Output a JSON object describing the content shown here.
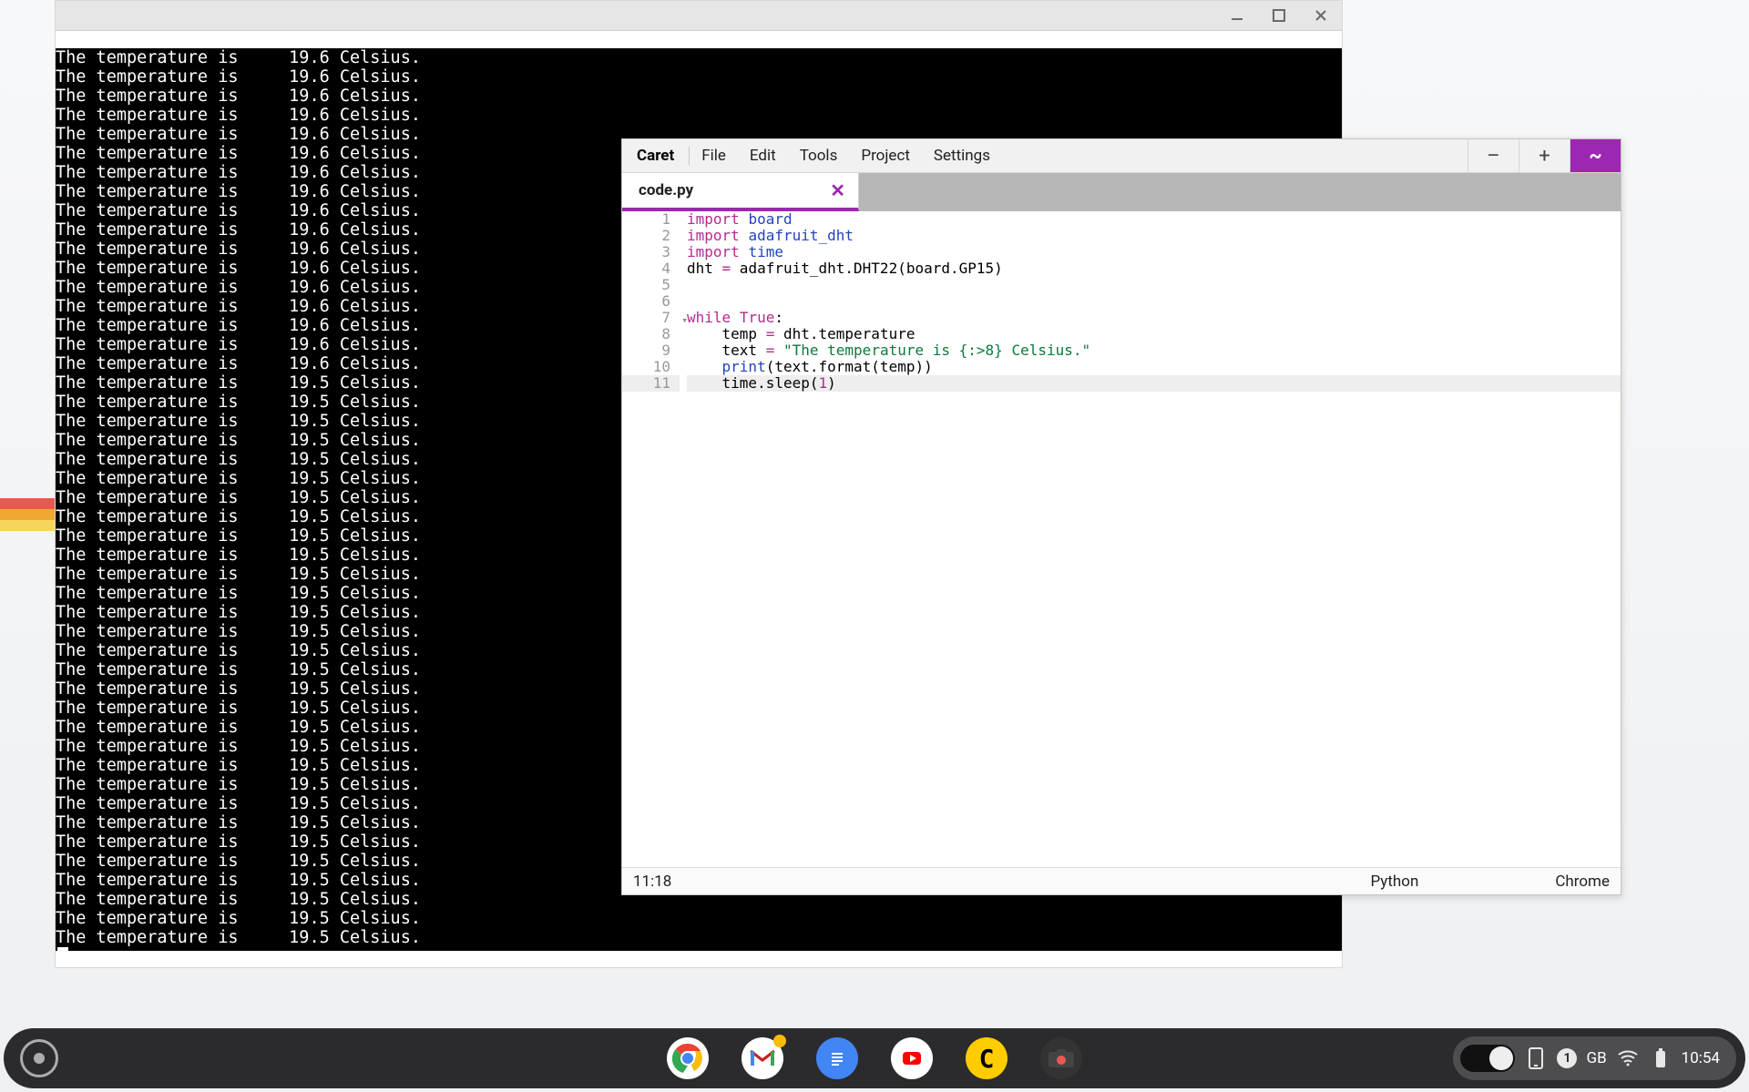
{
  "edge_tabs": [
    "#e85a4f",
    "#f0a830",
    "#f6d55c"
  ],
  "terminal": {
    "lines": [
      "The temperature is     19.6 Celsius.",
      "The temperature is     19.6 Celsius.",
      "The temperature is     19.6 Celsius.",
      "The temperature is     19.6 Celsius.",
      "The temperature is     19.6 Celsius.",
      "The temperature is     19.6 Celsius.",
      "The temperature is     19.6 Celsius.",
      "The temperature is     19.6 Celsius.",
      "The temperature is     19.6 Celsius.",
      "The temperature is     19.6 Celsius.",
      "The temperature is     19.6 Celsius.",
      "The temperature is     19.6 Celsius.",
      "The temperature is     19.6 Celsius.",
      "The temperature is     19.6 Celsius.",
      "The temperature is     19.6 Celsius.",
      "The temperature is     19.6 Celsius.",
      "The temperature is     19.6 Celsius.",
      "The temperature is     19.5 Celsius.",
      "The temperature is     19.5 Celsius.",
      "The temperature is     19.5 Celsius.",
      "The temperature is     19.5 Celsius.",
      "The temperature is     19.5 Celsius.",
      "The temperature is     19.5 Celsius.",
      "The temperature is     19.5 Celsius.",
      "The temperature is     19.5 Celsius.",
      "The temperature is     19.5 Celsius.",
      "The temperature is     19.5 Celsius.",
      "The temperature is     19.5 Celsius.",
      "The temperature is     19.5 Celsius.",
      "The temperature is     19.5 Celsius.",
      "The temperature is     19.5 Celsius.",
      "The temperature is     19.5 Celsius.",
      "The temperature is     19.5 Celsius.",
      "The temperature is     19.5 Celsius.",
      "The temperature is     19.5 Celsius.",
      "The temperature is     19.5 Celsius.",
      "The temperature is     19.5 Celsius.",
      "The temperature is     19.5 Celsius.",
      "The temperature is     19.5 Celsius.",
      "The temperature is     19.5 Celsius.",
      "The temperature is     19.5 Celsius.",
      "The temperature is     19.5 Celsius.",
      "The temperature is     19.5 Celsius.",
      "The temperature is     19.5 Celsius.",
      "The temperature is     19.5 Celsius.",
      "The temperature is     19.5 Celsius.",
      "The temperature is     19.5 Celsius."
    ]
  },
  "caret": {
    "brand": "Caret",
    "menu": [
      "File",
      "Edit",
      "Tools",
      "Project",
      "Settings"
    ],
    "win_close_glyph": "~",
    "tab": {
      "name": "code.py",
      "close": "✕"
    },
    "code": [
      {
        "n": 1,
        "html": "<span class='kw'>import</span> <span class='def'>board</span>"
      },
      {
        "n": 2,
        "html": "<span class='kw'>import</span> <span class='def'>adafruit_dht</span>"
      },
      {
        "n": 3,
        "html": "<span class='kw'>import</span> <span class='def'>time</span>"
      },
      {
        "n": 4,
        "html": "dht <span class='op'>=</span> adafruit_dht.DHT22(board.GP15)"
      },
      {
        "n": 5,
        "html": ""
      },
      {
        "n": 6,
        "html": ""
      },
      {
        "n": 7,
        "html": "<span class='kw'>while</span> <span class='kw'>True</span>:",
        "fold": true
      },
      {
        "n": 8,
        "html": "    temp <span class='op'>=</span> dht.temperature"
      },
      {
        "n": 9,
        "html": "    text <span class='op'>=</span> <span class='str'>\"The temperature is {:&gt;8} Celsius.\"</span>"
      },
      {
        "n": 10,
        "html": "    <span class='def'>print</span>(text.format(temp))"
      },
      {
        "n": 11,
        "html": "    time.sleep(<span class='num'>1</span>)",
        "hl": true
      }
    ],
    "status": {
      "pos": "11:18",
      "lang": "Python",
      "platform": "Chrome"
    }
  },
  "shelf": {
    "storage_badge": "1",
    "storage_unit": "GB",
    "clock": "10:54"
  }
}
